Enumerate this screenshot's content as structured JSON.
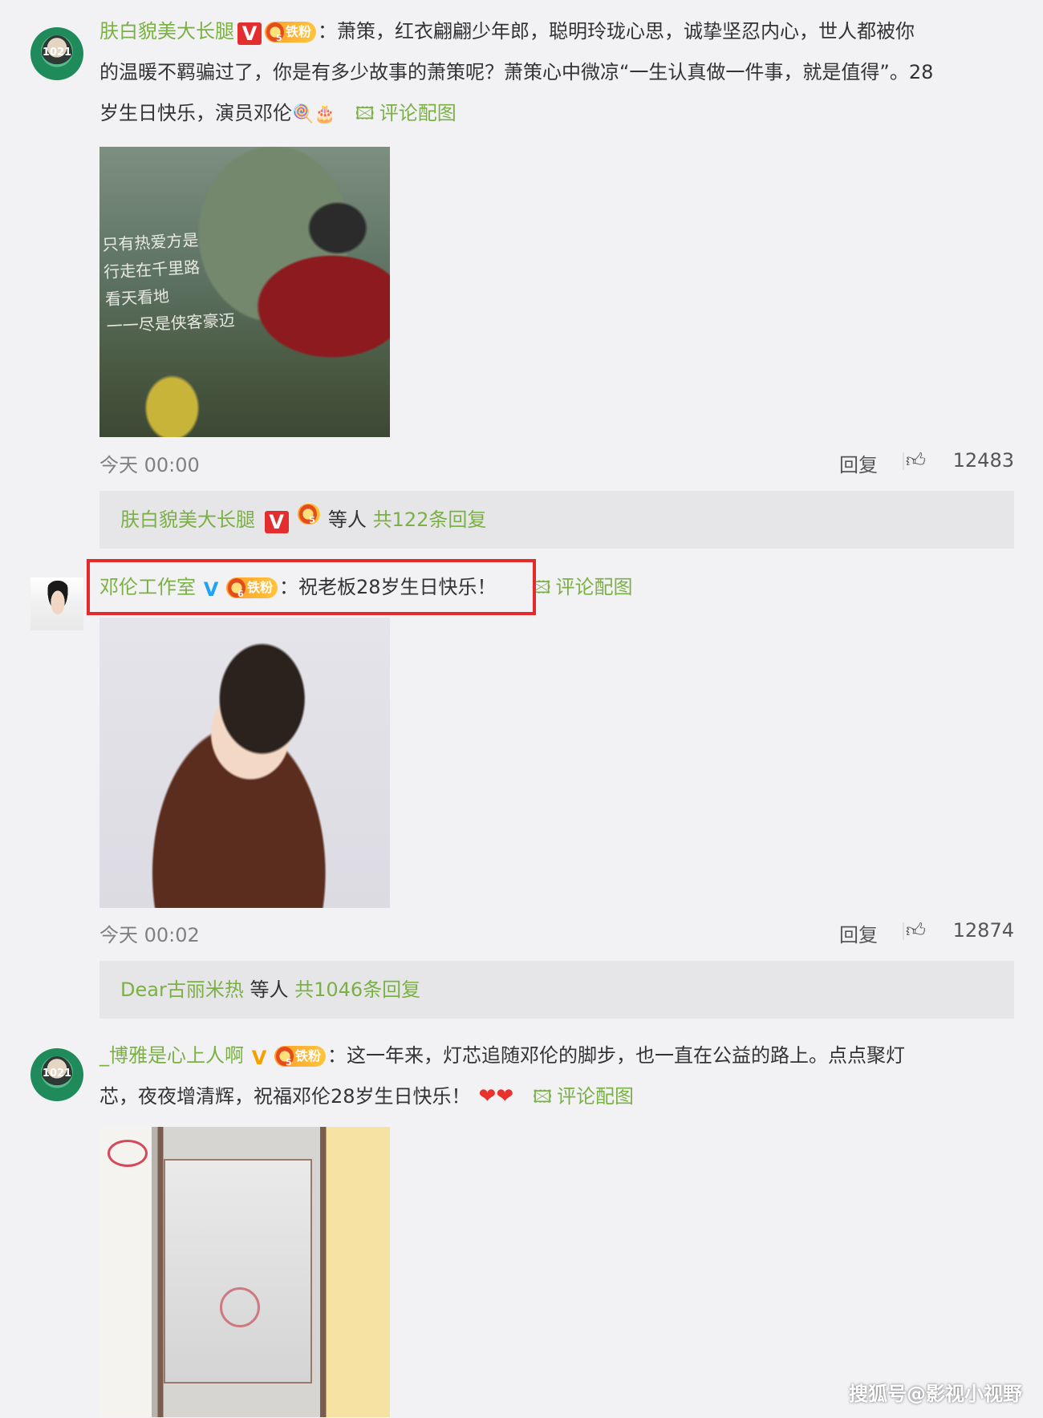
{
  "comments": [
    {
      "avatar_text": "1021",
      "username": "肤白貌美大长腿",
      "verified": "V",
      "fan_level": "5",
      "fan_label": "铁粉",
      "text_line1": "：萧策，红衣翩翩少年郎，聪明玲珑心思，诚挚坚忍内心，世人都被你",
      "text_line2": "的温暖不羁骗过了，你是有多少故事的萧策呢？萧策心中微凉“一生认真做一件事，就是值得”。28",
      "text_line3": "岁生日快乐，演员邓伦",
      "emoji": "🍭🎂",
      "pic_link": "评论配图",
      "image_caption": "只有热爱方是\n行走在千里路\n看天看地\n一一尽是侠客豪迈",
      "time": "今天 00:00",
      "reply_label": "回复",
      "likes": "12483",
      "replies_user": "肤白貌美大长腿",
      "replies_mid": "等人",
      "replies_count": "共122条回复"
    },
    {
      "username": "邓伦工作室",
      "verified": "V",
      "fan_level": "6",
      "fan_label": "铁粉",
      "text": "：祝老板28岁生日快乐！",
      "pic_link": "评论配图",
      "time": "今天 00:02",
      "reply_label": "回复",
      "likes": "12874",
      "replies_user": "Dear古丽米热",
      "replies_mid": "等人",
      "replies_count": "共1046条回复"
    },
    {
      "avatar_text": "1021",
      "username": "_博雅是心上人啊",
      "verified": "V",
      "fan_level": "5",
      "fan_label": "铁粉",
      "text_line1": "：这一年来，灯芯追随邓伦的脚步，也一直在公益的路上。点点聚灯",
      "text_line2": "芯，夜夜增清辉，祝福邓伦28岁生日快乐！",
      "emoji": "❤❤",
      "pic_link": "评论配图"
    }
  ],
  "watermark": "搜狐号@影视小视野",
  "colors": {
    "username": "#7bb045",
    "highlight": "#e52a2e",
    "verified_red": "#e22e2e",
    "verified_gold": "#f3a100",
    "verified_blue": "#21a3f5"
  }
}
